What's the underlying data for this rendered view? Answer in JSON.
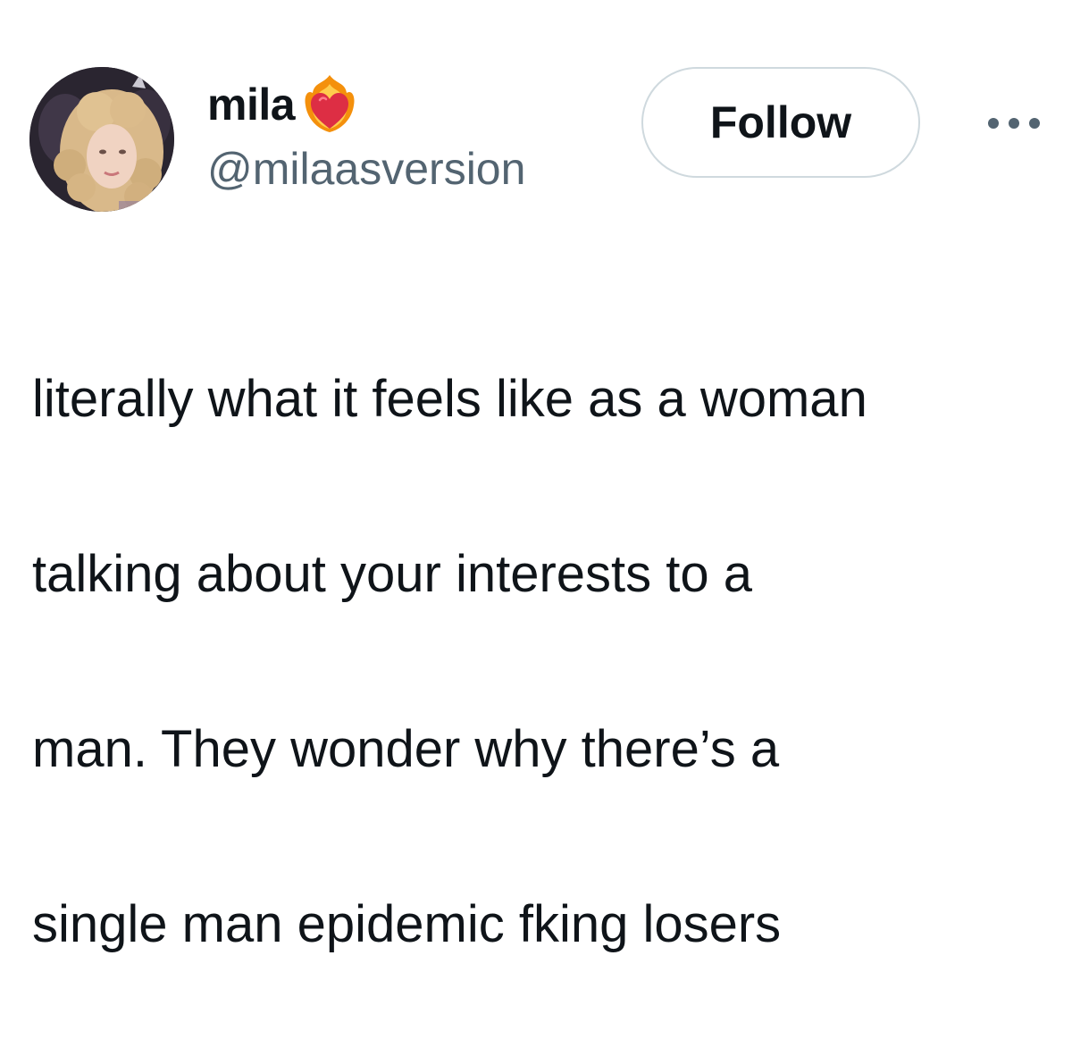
{
  "author": {
    "display_name": "mila",
    "handle": "@milaasversion",
    "name_badge_icon": "heart-on-fire-icon",
    "avatar_icon": "profile-photo"
  },
  "actions": {
    "follow_label": "Follow",
    "more_icon": "more-options-icon"
  },
  "tweet": {
    "lines": [
      "literally what it feels like as a woman",
      "talking about your interests to a",
      "man. They wonder why there’s a",
      "single man epidemic fking losers"
    ]
  },
  "colors": {
    "text_primary": "#0f1419",
    "text_secondary": "#536471",
    "button_border": "#cfd9de",
    "background": "#ffffff"
  }
}
